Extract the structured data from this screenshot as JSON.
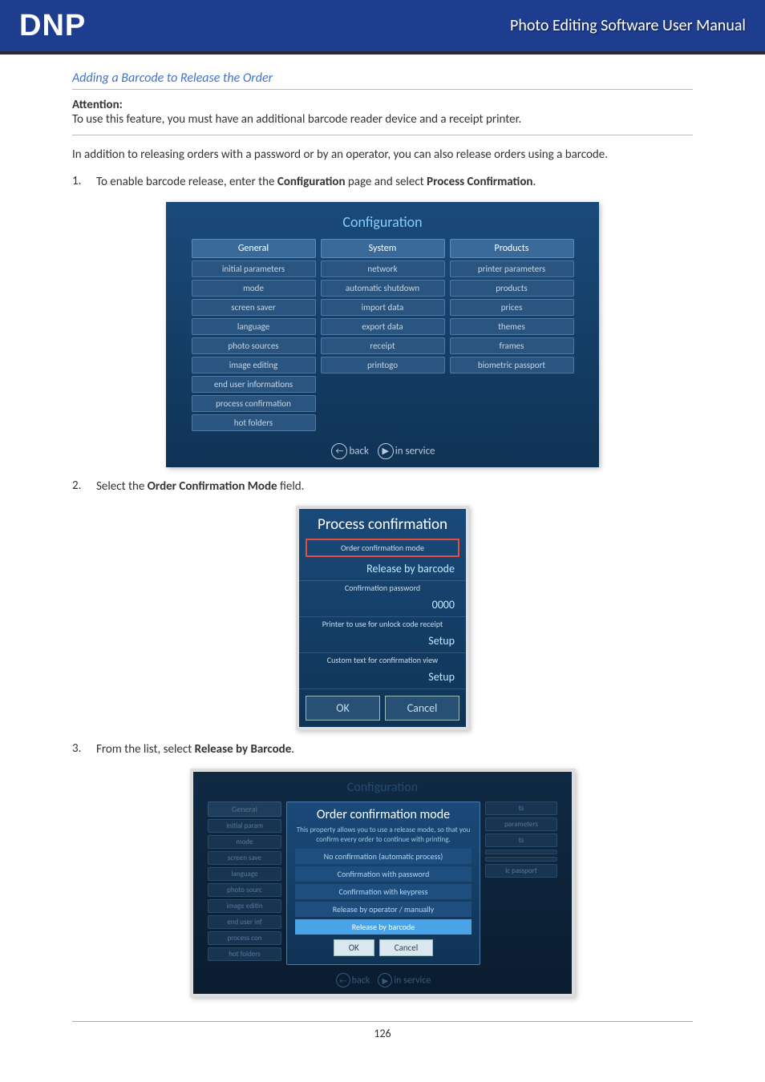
{
  "header": {
    "logo": "DNP",
    "title": "Photo Editing Software User Manual"
  },
  "section_title": "Adding a Barcode to Release the Order",
  "attention": {
    "label": "Attention:",
    "text": "To use this feature, you must have an additional barcode reader device and a receipt printer."
  },
  "intro": "In addition to releasing orders with a password or by an operator, you can also release orders using a barcode.",
  "steps": {
    "s1_num": "1.",
    "s1_a": "To enable barcode release, enter the ",
    "s1_b": "Configuration",
    "s1_c": " page and select ",
    "s1_d": "Process Confirmation",
    "s1_e": ".",
    "s2_num": "2.",
    "s2_a": "Select the ",
    "s2_b": "Order Confirmation Mode",
    "s2_c": " field.",
    "s3_num": "3.",
    "s3_a": "From the list, select ",
    "s3_b": "Release by Barcode",
    "s3_c": "."
  },
  "shot1": {
    "title": "Configuration",
    "cols": [
      {
        "head": "General",
        "items": [
          "initial parameters",
          "mode",
          "screen saver",
          "language",
          "photo sources",
          "image editing",
          "end user informations",
          "process confirmation",
          "hot folders"
        ]
      },
      {
        "head": "System",
        "items": [
          "network",
          "automatic shutdown",
          "import data",
          "export data",
          "receipt",
          "printogo"
        ]
      },
      {
        "head": "Products",
        "items": [
          "printer parameters",
          "products",
          "prices",
          "themes",
          "frames",
          "biometric passport"
        ]
      }
    ],
    "back": "back",
    "inservice": "in service"
  },
  "shot2": {
    "title": "Process confirmation",
    "f1_label": "Order confirmation mode",
    "f1_value": "Release by barcode",
    "f2_label": "Confirmation password",
    "f2_value": "0000",
    "f3_label": "Printer to use for unlock code receipt",
    "f3_value": "Setup",
    "f4_label": "Custom text for confirmation view",
    "f4_value": "Setup",
    "ok": "OK",
    "cancel": "Cancel"
  },
  "shot3": {
    "title_dim": "Configuration",
    "left_head": "General",
    "left_items": [
      "initial param",
      "mode",
      "screen save",
      "language",
      "photo sourc",
      "image editin",
      "end user inf",
      "process con",
      "hot folders"
    ],
    "right_items": [
      "ts",
      "parameters",
      "ts",
      "",
      "",
      "ic passport"
    ],
    "center": {
      "title": "Order confirmation mode",
      "desc": "This property allows you to use a release mode, so that you confirm every order to continue with printing.",
      "options": [
        "No confirmation (automatic process)",
        "Confirmation with password",
        "Confirmation with keypress",
        "Release by operator / manually",
        "Release by barcode"
      ],
      "selected_index": 4,
      "ok": "OK",
      "cancel": "Cancel"
    },
    "back": "back",
    "inservice": "in service"
  },
  "page_number": "126"
}
